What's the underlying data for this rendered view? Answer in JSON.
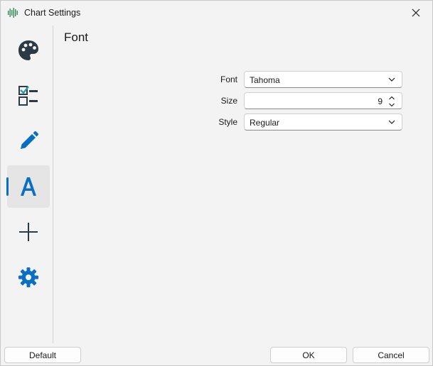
{
  "window": {
    "title": "Chart Settings",
    "app_icon": "waveform-icon",
    "close_icon": "close-icon"
  },
  "sidebar": {
    "items": [
      {
        "name": "appearance",
        "icon": "palette-icon"
      },
      {
        "name": "checklist",
        "icon": "checklist-icon"
      },
      {
        "name": "edit",
        "icon": "pencil-icon"
      },
      {
        "name": "font",
        "icon": "font-a-icon",
        "selected": true
      },
      {
        "name": "crosshair",
        "icon": "plus-icon"
      },
      {
        "name": "settings",
        "icon": "gear-icon"
      }
    ]
  },
  "section": {
    "title": "Font"
  },
  "form": {
    "font_label": "Font",
    "font_value": "Tahoma",
    "size_label": "Size",
    "size_value": "9",
    "style_label": "Style",
    "style_value": "Regular"
  },
  "footer": {
    "default_label": "Default",
    "ok_label": "OK",
    "cancel_label": "Cancel"
  },
  "colors": {
    "accent": "#0a6fc2",
    "icon_dark": "#2b3a44",
    "app_icon_green": "#2e8b57"
  }
}
